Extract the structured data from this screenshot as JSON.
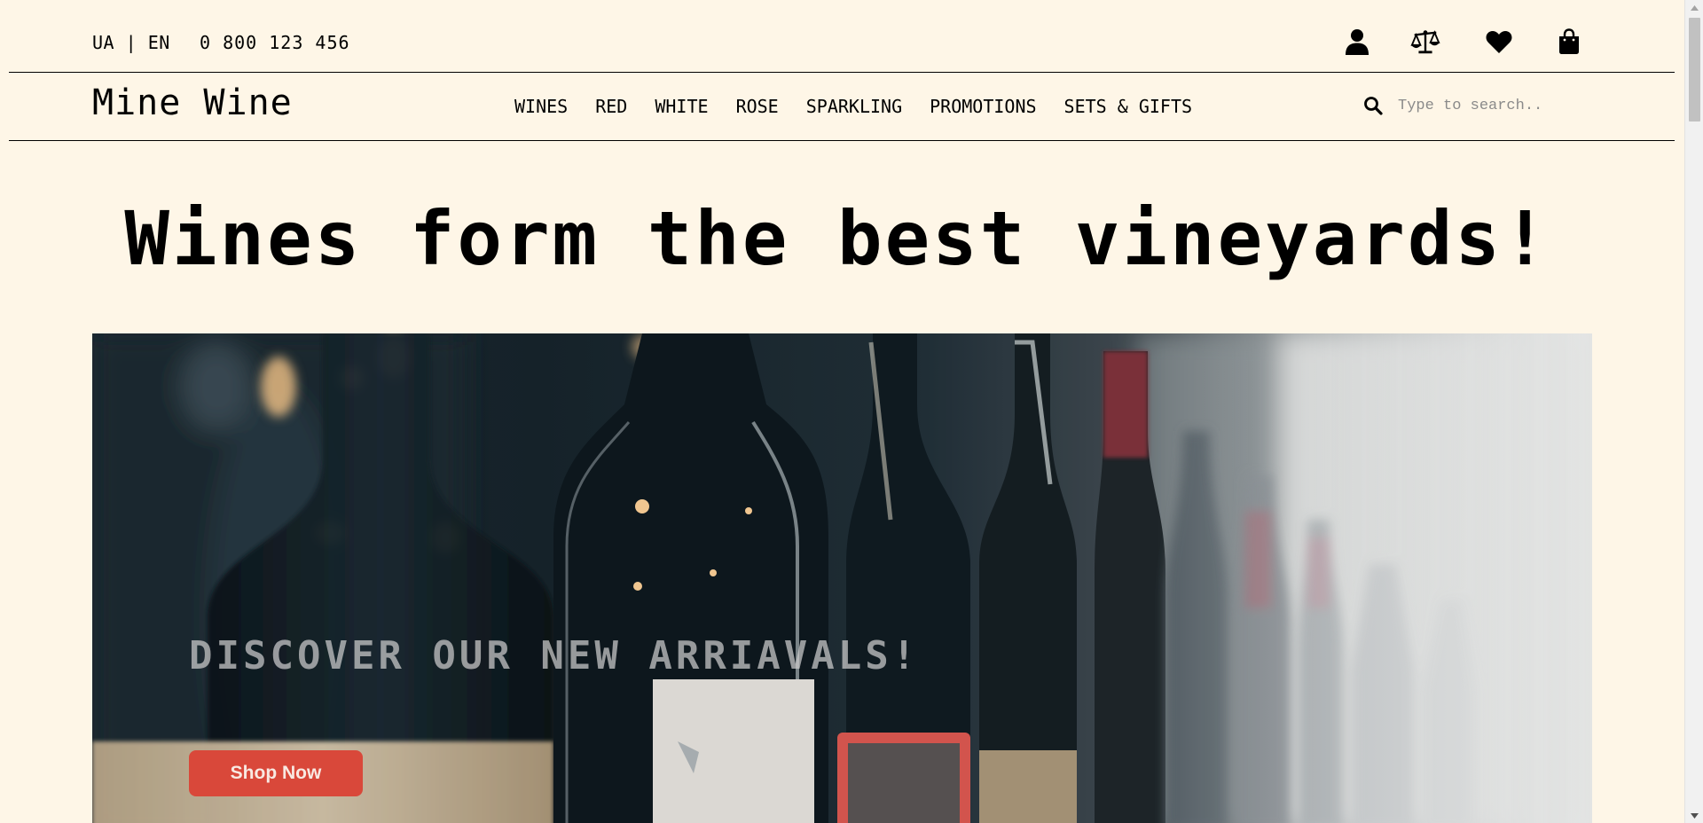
{
  "topbar": {
    "language": "UA | EN",
    "phone": "0 800 123 456",
    "icons": [
      "user-icon",
      "scales-icon",
      "heart-icon",
      "shopping-bag-icon"
    ]
  },
  "header": {
    "logo": "Mine Wine",
    "nav": [
      "WINES",
      "RED",
      "WHITE",
      "ROSE",
      "SPARKLING",
      "PROMOTIONS",
      "SETS & GIFTS"
    ],
    "search": {
      "placeholder": "Type to search..",
      "value": ""
    }
  },
  "main": {
    "headline": "Wines form the best vineyards!",
    "hero": {
      "title": "DISCOVER OUR NEW ARRIAVALS!",
      "button_label": "Shop Now",
      "button_color": "#d9483a"
    }
  },
  "colors": {
    "background": "#fef6e7",
    "text": "#000000",
    "accent": "#d9483a"
  }
}
